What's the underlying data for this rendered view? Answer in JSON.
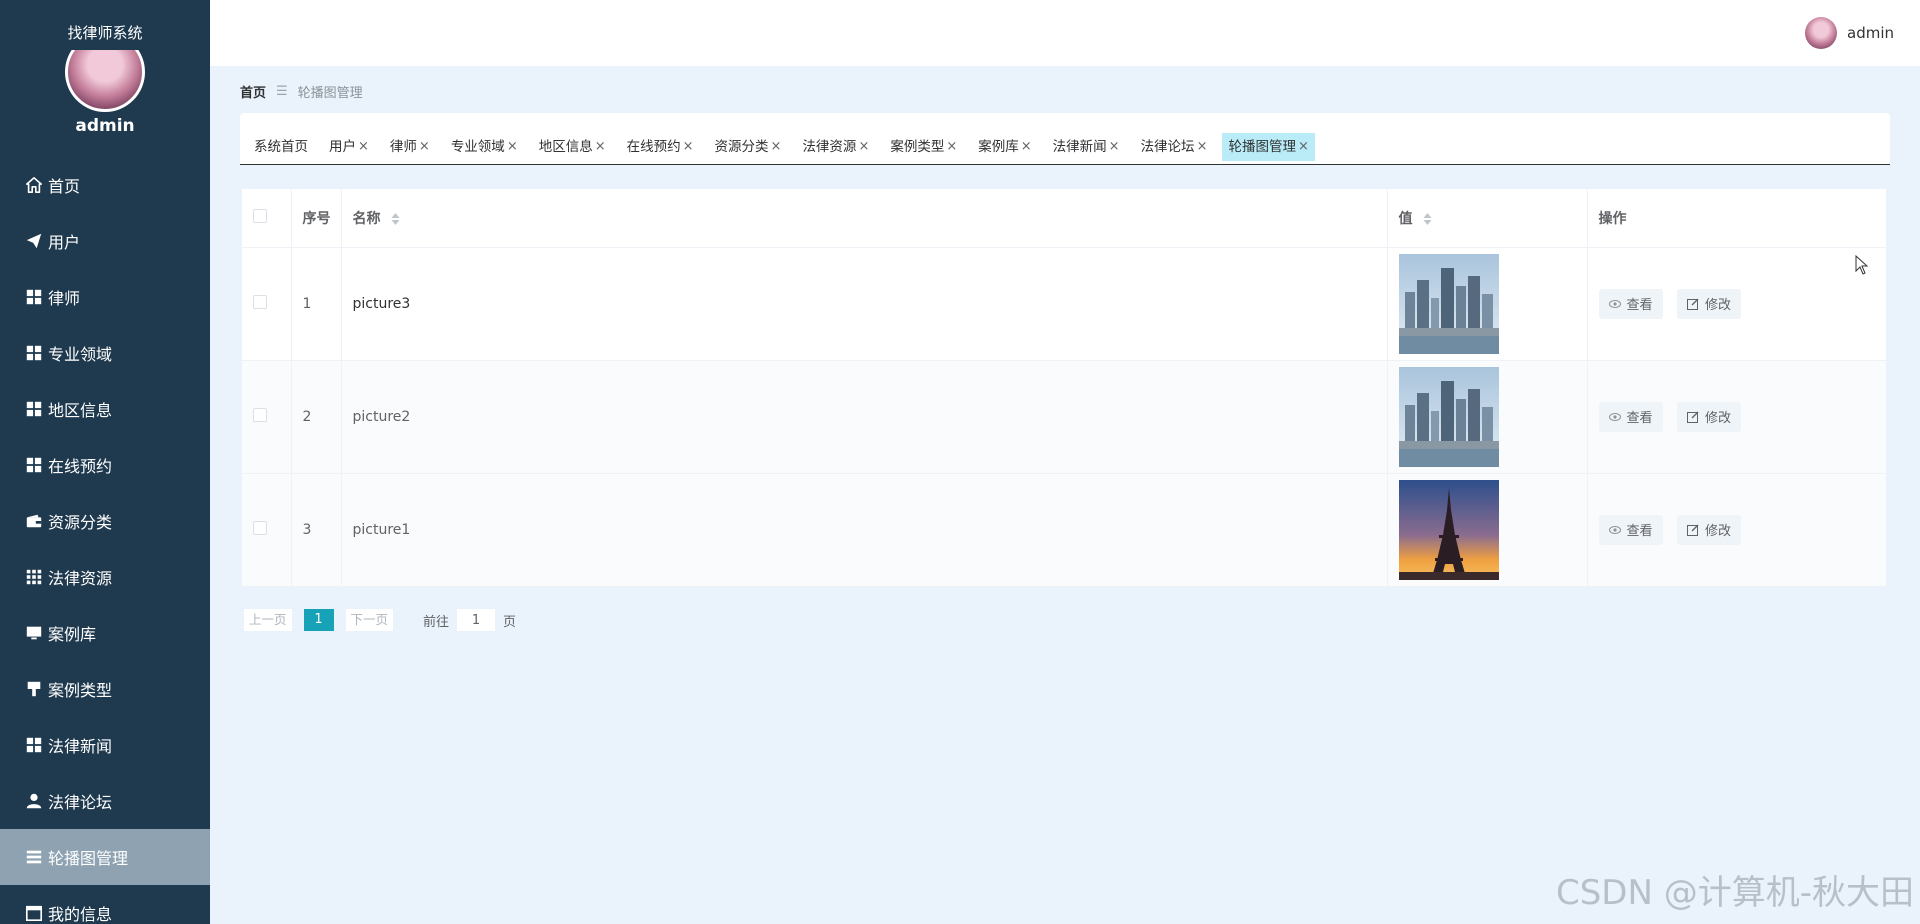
{
  "app": {
    "title": "找律师系统",
    "user_name": "admin"
  },
  "sidebar": {
    "items": [
      {
        "label": "首页",
        "icon": "home-icon"
      },
      {
        "label": "用户",
        "icon": "paper-plane-icon"
      },
      {
        "label": "律师",
        "icon": "grid-icon"
      },
      {
        "label": "专业领域",
        "icon": "grid-icon"
      },
      {
        "label": "地区信息",
        "icon": "grid-icon"
      },
      {
        "label": "在线预约",
        "icon": "grid-icon"
      },
      {
        "label": "资源分类",
        "icon": "wallet-icon"
      },
      {
        "label": "法律资源",
        "icon": "grid-dots-icon"
      },
      {
        "label": "案例库",
        "icon": "monitor-icon"
      },
      {
        "label": "案例类型",
        "icon": "brush-icon"
      },
      {
        "label": "法律新闻",
        "icon": "grid-icon"
      },
      {
        "label": "法律论坛",
        "icon": "user-icon"
      },
      {
        "label": "轮播图管理",
        "icon": "list-icon",
        "active": true
      },
      {
        "label": "我的信息",
        "icon": "calendar-icon"
      }
    ]
  },
  "topbar": {
    "user_name": "admin"
  },
  "breadcrumb": {
    "home": "首页",
    "separator": "☰",
    "current": "轮播图管理"
  },
  "tags": [
    {
      "label": "系统首页",
      "closable": false
    },
    {
      "label": "用户",
      "closable": true
    },
    {
      "label": "律师",
      "closable": true
    },
    {
      "label": "专业领域",
      "closable": true
    },
    {
      "label": "地区信息",
      "closable": true
    },
    {
      "label": "在线预约",
      "closable": true
    },
    {
      "label": "资源分类",
      "closable": true
    },
    {
      "label": "法律资源",
      "closable": true
    },
    {
      "label": "案例类型",
      "closable": true
    },
    {
      "label": "案例库",
      "closable": true
    },
    {
      "label": "法律新闻",
      "closable": true
    },
    {
      "label": "法律论坛",
      "closable": true
    },
    {
      "label": "轮播图管理",
      "closable": true,
      "active": true
    }
  ],
  "table": {
    "columns": {
      "index": "序号",
      "name": "名称",
      "value": "值",
      "actions": "操作"
    },
    "rows": [
      {
        "index": "1",
        "name": "picture3",
        "image": "city-skyline"
      },
      {
        "index": "2",
        "name": "picture2",
        "image": "city-skyline"
      },
      {
        "index": "3",
        "name": "picture1",
        "image": "eiffel-tower-sunset"
      }
    ],
    "view_label": "查看",
    "edit_label": "修改"
  },
  "pagination": {
    "prev": "上一页",
    "current": "1",
    "next": "下一页",
    "goto_label": "前往",
    "goto_value": "1",
    "unit": "页"
  },
  "watermark": "CSDN @计算机-秋大田",
  "colors": {
    "sidebar_bg": "#1f3a4f",
    "sidebar_active": "#8ea2b1",
    "accent": "#17a2b8",
    "active_tag": "#b9ecf6",
    "page_bg": "#eaf3fb"
  }
}
